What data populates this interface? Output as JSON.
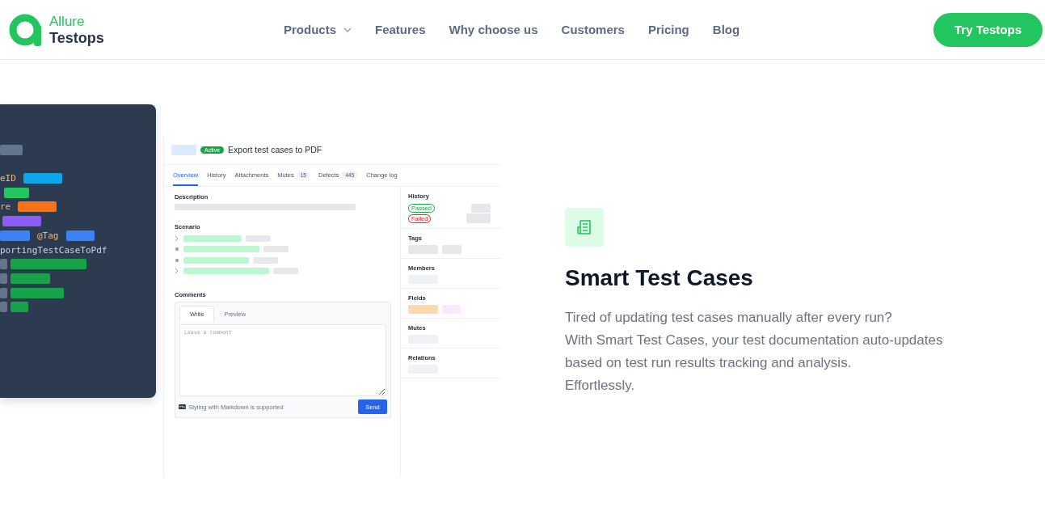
{
  "header": {
    "logo": {
      "line1": "Allure",
      "line2": "Testops"
    },
    "nav": [
      {
        "label": "Products",
        "dropdown": true
      },
      {
        "label": "Features",
        "dropdown": false
      },
      {
        "label": "Why choose us",
        "dropdown": false
      },
      {
        "label": "Customers",
        "dropdown": false
      },
      {
        "label": "Pricing",
        "dropdown": false
      },
      {
        "label": "Blog",
        "dropdown": false
      }
    ],
    "cta": "Try Testops"
  },
  "code_panel": {
    "texts": [
      "eID",
      "re",
      "@Tag",
      "portingTestCaseToPdf"
    ]
  },
  "app": {
    "status": "Active",
    "title": "Export test cases to PDF",
    "tabs": [
      {
        "label": "Overview",
        "selected": true
      },
      {
        "label": "History",
        "selected": false
      },
      {
        "label": "Attachments",
        "selected": false
      },
      {
        "label": "Mutes",
        "count": "15",
        "selected": false
      },
      {
        "label": "Defects",
        "count": "445",
        "selected": false
      },
      {
        "label": "Change log",
        "selected": false
      }
    ],
    "description_label": "Description",
    "scenario_label": "Scenario",
    "scenario_steps": [
      {
        "kind": "group"
      },
      {
        "kind": "step"
      },
      {
        "kind": "step"
      },
      {
        "kind": "group"
      }
    ],
    "comments": {
      "label": "Comments",
      "tabs": [
        {
          "label": "Write",
          "selected": true
        },
        {
          "label": "Preview",
          "selected": false
        }
      ],
      "placeholder": "Leave a comment",
      "hint": "Styling with Markdown is supported",
      "send": "Send"
    },
    "side": [
      {
        "label": "History",
        "kind": "history",
        "badges": [
          {
            "label": "Passed",
            "color": "#16a34a"
          },
          {
            "label": "Failed",
            "color": "#dc2626"
          }
        ]
      },
      {
        "label": "Tags",
        "kind": "tags"
      },
      {
        "label": "Members",
        "kind": "single"
      },
      {
        "label": "Fields",
        "kind": "fields"
      },
      {
        "label": "Mutes",
        "kind": "single"
      },
      {
        "label": "Relations",
        "kind": "single"
      }
    ]
  },
  "feature": {
    "title": "Smart Test Cases",
    "lines": [
      "Tired of updating test cases manually after every run?",
      "With Smart Test Cases, your test documentation auto-updates",
      "based on test run results tracking and analysis.",
      "Effortlessly."
    ]
  }
}
